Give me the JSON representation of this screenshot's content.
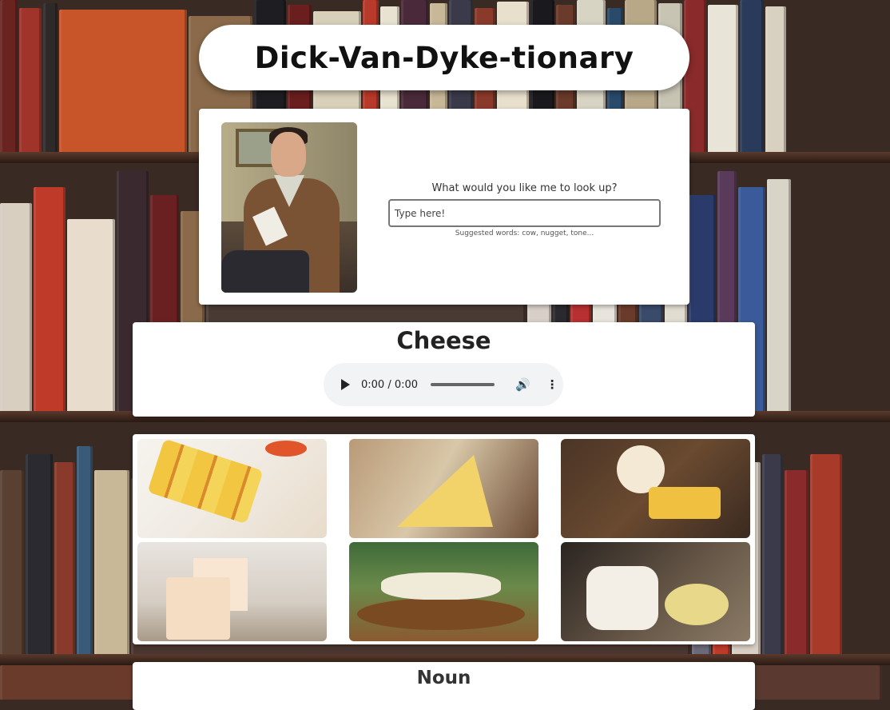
{
  "app": {
    "title": "Dick-Van-Dyke-tionary"
  },
  "search": {
    "prompt": "What would you like me to look up?",
    "placeholder": "Type here!",
    "suggestions": "Suggested words: cow, nugget, tone..."
  },
  "word": {
    "title": "Cheese",
    "audio_time": "0:00 / 0:00"
  },
  "images": [
    {
      "label": "paneer skewers"
    },
    {
      "label": "swiss cheese wedge"
    },
    {
      "label": "cheese board with honey"
    },
    {
      "label": "cheese cubes"
    },
    {
      "label": "cheese platter"
    },
    {
      "label": "brie with dip"
    }
  ],
  "sections": [
    {
      "part_of_speech": "Noun"
    }
  ],
  "icons": {
    "play": "play-icon",
    "volume": "volume-icon",
    "more": "more-vertical-icon"
  }
}
